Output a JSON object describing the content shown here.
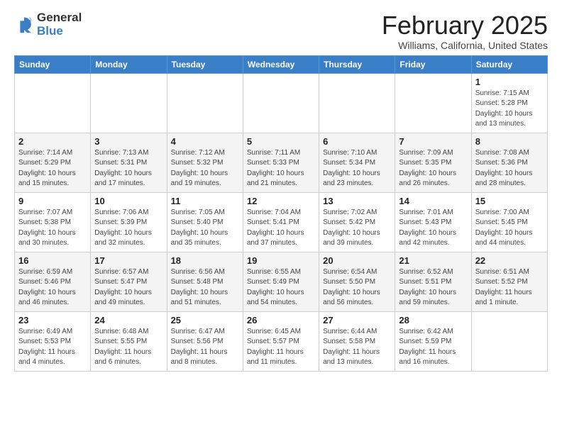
{
  "logo": {
    "general": "General",
    "blue": "Blue"
  },
  "title": "February 2025",
  "location": "Williams, California, United States",
  "days_of_week": [
    "Sunday",
    "Monday",
    "Tuesday",
    "Wednesday",
    "Thursday",
    "Friday",
    "Saturday"
  ],
  "weeks": [
    [
      {
        "day": "",
        "info": ""
      },
      {
        "day": "",
        "info": ""
      },
      {
        "day": "",
        "info": ""
      },
      {
        "day": "",
        "info": ""
      },
      {
        "day": "",
        "info": ""
      },
      {
        "day": "",
        "info": ""
      },
      {
        "day": "1",
        "info": "Sunrise: 7:15 AM\nSunset: 5:28 PM\nDaylight: 10 hours\nand 13 minutes."
      }
    ],
    [
      {
        "day": "2",
        "info": "Sunrise: 7:14 AM\nSunset: 5:29 PM\nDaylight: 10 hours\nand 15 minutes."
      },
      {
        "day": "3",
        "info": "Sunrise: 7:13 AM\nSunset: 5:31 PM\nDaylight: 10 hours\nand 17 minutes."
      },
      {
        "day": "4",
        "info": "Sunrise: 7:12 AM\nSunset: 5:32 PM\nDaylight: 10 hours\nand 19 minutes."
      },
      {
        "day": "5",
        "info": "Sunrise: 7:11 AM\nSunset: 5:33 PM\nDaylight: 10 hours\nand 21 minutes."
      },
      {
        "day": "6",
        "info": "Sunrise: 7:10 AM\nSunset: 5:34 PM\nDaylight: 10 hours\nand 23 minutes."
      },
      {
        "day": "7",
        "info": "Sunrise: 7:09 AM\nSunset: 5:35 PM\nDaylight: 10 hours\nand 26 minutes."
      },
      {
        "day": "8",
        "info": "Sunrise: 7:08 AM\nSunset: 5:36 PM\nDaylight: 10 hours\nand 28 minutes."
      }
    ],
    [
      {
        "day": "9",
        "info": "Sunrise: 7:07 AM\nSunset: 5:38 PM\nDaylight: 10 hours\nand 30 minutes."
      },
      {
        "day": "10",
        "info": "Sunrise: 7:06 AM\nSunset: 5:39 PM\nDaylight: 10 hours\nand 32 minutes."
      },
      {
        "day": "11",
        "info": "Sunrise: 7:05 AM\nSunset: 5:40 PM\nDaylight: 10 hours\nand 35 minutes."
      },
      {
        "day": "12",
        "info": "Sunrise: 7:04 AM\nSunset: 5:41 PM\nDaylight: 10 hours\nand 37 minutes."
      },
      {
        "day": "13",
        "info": "Sunrise: 7:02 AM\nSunset: 5:42 PM\nDaylight: 10 hours\nand 39 minutes."
      },
      {
        "day": "14",
        "info": "Sunrise: 7:01 AM\nSunset: 5:43 PM\nDaylight: 10 hours\nand 42 minutes."
      },
      {
        "day": "15",
        "info": "Sunrise: 7:00 AM\nSunset: 5:45 PM\nDaylight: 10 hours\nand 44 minutes."
      }
    ],
    [
      {
        "day": "16",
        "info": "Sunrise: 6:59 AM\nSunset: 5:46 PM\nDaylight: 10 hours\nand 46 minutes."
      },
      {
        "day": "17",
        "info": "Sunrise: 6:57 AM\nSunset: 5:47 PM\nDaylight: 10 hours\nand 49 minutes."
      },
      {
        "day": "18",
        "info": "Sunrise: 6:56 AM\nSunset: 5:48 PM\nDaylight: 10 hours\nand 51 minutes."
      },
      {
        "day": "19",
        "info": "Sunrise: 6:55 AM\nSunset: 5:49 PM\nDaylight: 10 hours\nand 54 minutes."
      },
      {
        "day": "20",
        "info": "Sunrise: 6:54 AM\nSunset: 5:50 PM\nDaylight: 10 hours\nand 56 minutes."
      },
      {
        "day": "21",
        "info": "Sunrise: 6:52 AM\nSunset: 5:51 PM\nDaylight: 10 hours\nand 59 minutes."
      },
      {
        "day": "22",
        "info": "Sunrise: 6:51 AM\nSunset: 5:52 PM\nDaylight: 11 hours\nand 1 minute."
      }
    ],
    [
      {
        "day": "23",
        "info": "Sunrise: 6:49 AM\nSunset: 5:53 PM\nDaylight: 11 hours\nand 4 minutes."
      },
      {
        "day": "24",
        "info": "Sunrise: 6:48 AM\nSunset: 5:55 PM\nDaylight: 11 hours\nand 6 minutes."
      },
      {
        "day": "25",
        "info": "Sunrise: 6:47 AM\nSunset: 5:56 PM\nDaylight: 11 hours\nand 8 minutes."
      },
      {
        "day": "26",
        "info": "Sunrise: 6:45 AM\nSunset: 5:57 PM\nDaylight: 11 hours\nand 11 minutes."
      },
      {
        "day": "27",
        "info": "Sunrise: 6:44 AM\nSunset: 5:58 PM\nDaylight: 11 hours\nand 13 minutes."
      },
      {
        "day": "28",
        "info": "Sunrise: 6:42 AM\nSunset: 5:59 PM\nDaylight: 11 hours\nand 16 minutes."
      },
      {
        "day": "",
        "info": ""
      }
    ]
  ]
}
